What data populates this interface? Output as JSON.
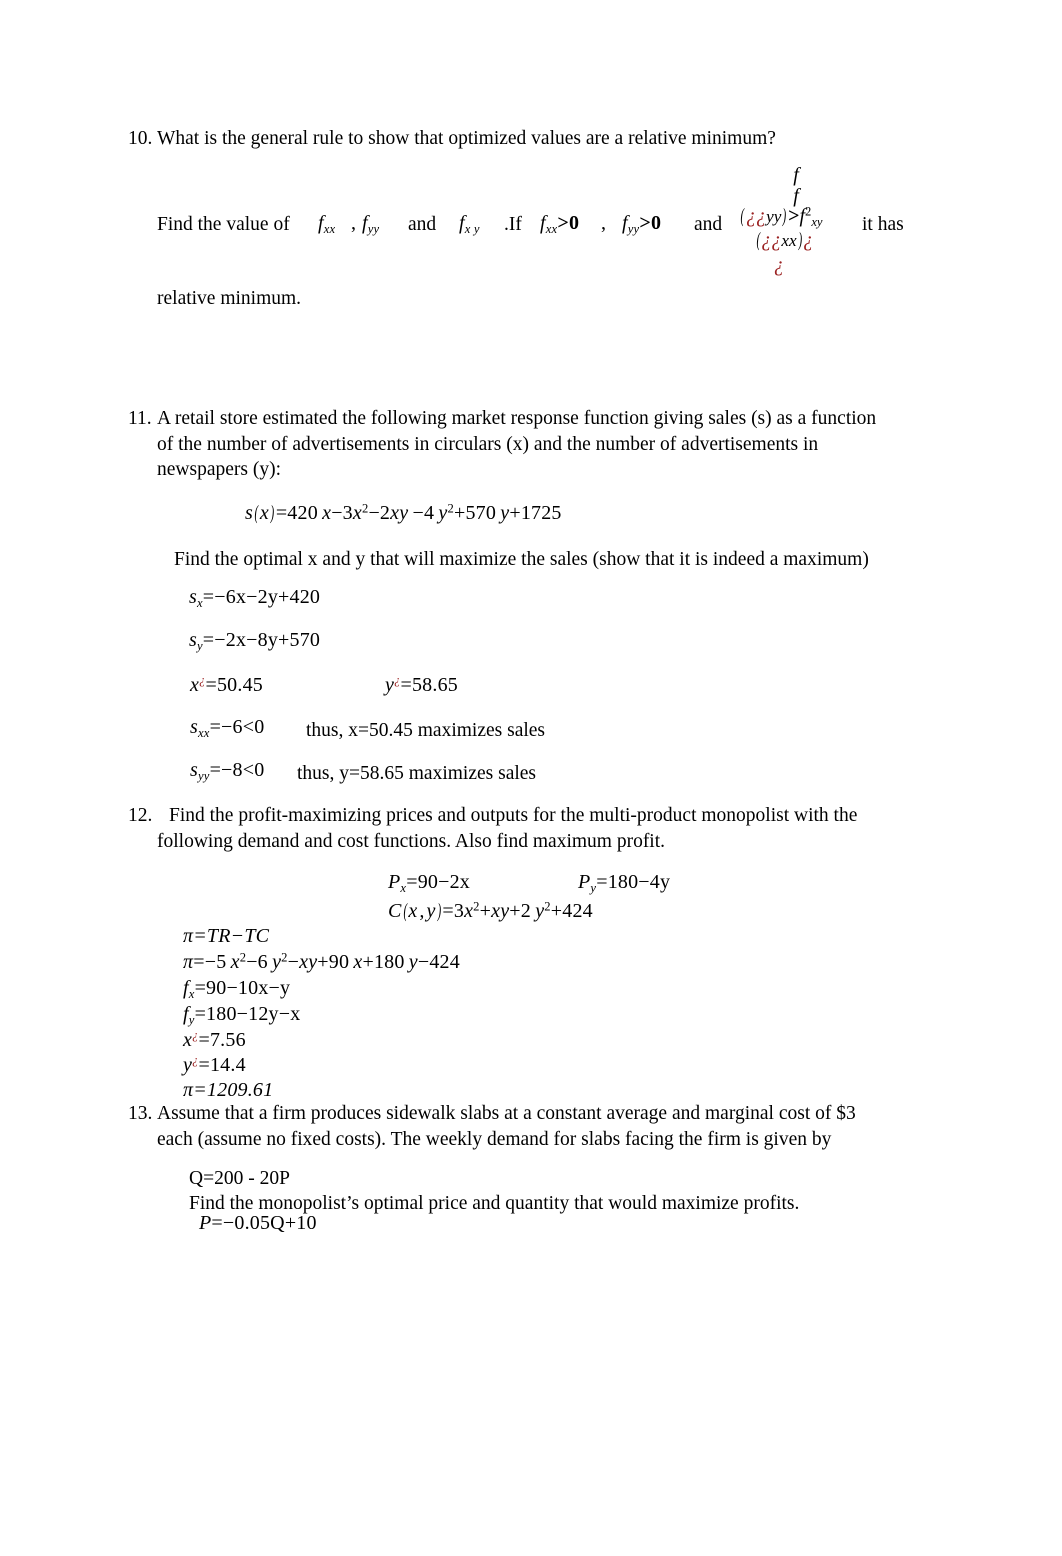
{
  "document": {
    "type": "math-worksheet",
    "page_background": "#ffffff",
    "error_glyph": "¿",
    "error_glyph_color": "#9B2222"
  },
  "questions": [
    {
      "number": "10.",
      "prompt": "What is the general rule to show that optimized values are a relative minimum?",
      "body_lines": [
        "Find the value of",
        "relative minimum."
      ],
      "inline": {
        "find_value_of": "Find the value of",
        "f_xx": "f",
        "f_xx_sub": "xx",
        "comma": ",",
        "f_yy": "f",
        "f_yy_sub": "yy",
        "and_1": "and",
        "f_xy": "f",
        "f_xy_sub": "x y",
        "if": ".If",
        "f_xx2": "f",
        "f_xx2_sub": "xx",
        "gt0_1": ">0",
        "comma2": ",",
        "f_yy2": "f",
        "f_yy2_sub": "yy",
        "gt0_2": ">0",
        "and_2": "and",
        "it_has": "it has",
        "relative_minimum": "relative minimum."
      },
      "stacked_expression": {
        "line1": "f",
        "line2": "f",
        "line3_open": "(",
        "line3_err": "¿¿",
        "line3_sub": "yy",
        "line3_close": ")",
        "line3_gt": ">",
        "line3_f": "f",
        "line3_f_sup": "2",
        "line3_f_sub": "xy",
        "line4_open": "(",
        "line4_err": "¿¿",
        "line4_sub": "xx",
        "line4_close": ")",
        "line4_err2": "¿",
        "line5_err": "¿"
      }
    },
    {
      "number": "11.",
      "prompt_line1": "A retail store estimated the following market response function giving sales (s) as a function",
      "prompt_line2": "of the number of advertisements in circulars (x) and the number of advertisements in",
      "prompt_line3": "newspapers (y):",
      "main_function": "s(x)=420x−3x²−2xy−4y²+570y+1725",
      "instruction": "Find the optimal x and y that will maximize the sales (show that it is indeed a maximum)",
      "solution": {
        "s_x": "s",
        "s_x_sub": "x",
        "s_x_rhs": "=−6x−2y+420",
        "s_y": "s",
        "s_y_sub": "y",
        "s_y_rhs": "=−2x−8y+570",
        "x_star": "x",
        "x_star_value": "=50.45",
        "y_star": "y",
        "y_star_value": "=58.65",
        "s_xx": "s",
        "s_xx_sub": "xx",
        "s_xx_rhs": "=−6<0",
        "s_xx_note": "thus, x=50.45 maximizes sales",
        "s_yy": "s",
        "s_yy_sub": "yy",
        "s_yy_rhs": "=−8<0",
        "s_yy_note": "thus, y=58.65 maximizes sales"
      }
    },
    {
      "number": "12.",
      "prompt_line1": "Find the profit-maximizing prices and outputs for the multi-product monopolist with the",
      "prompt_line2": "following demand and cost functions. Also find maximum profit.",
      "demand": {
        "P_x": "P",
        "P_x_sub": "x",
        "P_x_rhs": "=90−2x",
        "P_y": "P",
        "P_y_sub": "y",
        "P_y_rhs": "=180−4y",
        "C": "C",
        "C_args": "(x,y)",
        "C_rhs": "=3x²+xy+2y²+424"
      },
      "solution": {
        "pi_def": "π=TR−TC",
        "pi_expanded": "π=−5x²−6y²−xy+90x+180y−424",
        "f_x": "f",
        "f_x_sub": "x",
        "f_x_rhs": "=90−10x−y",
        "f_y": "f",
        "f_y_sub": "y",
        "f_y_rhs": "=180−12y−x",
        "x_star": "x",
        "x_star_value": "=7.56",
        "y_star": "y",
        "y_star_value": "=14.4",
        "pi_value": "π=1209.61"
      }
    },
    {
      "number": "13.",
      "prompt_line1": "Assume that a firm produces sidewalk slabs at a constant average and marginal cost of $3",
      "prompt_line2": "each (assume no fixed costs). The weekly demand for slabs facing the firm is given by",
      "demand_eq": "Q=200 - 20P",
      "instruction": "Find the monopolist’s optimal price and quantity that would maximize profits.",
      "inverse_demand": {
        "P": "P",
        "rhs": "=−0.05Q+10"
      }
    }
  ]
}
